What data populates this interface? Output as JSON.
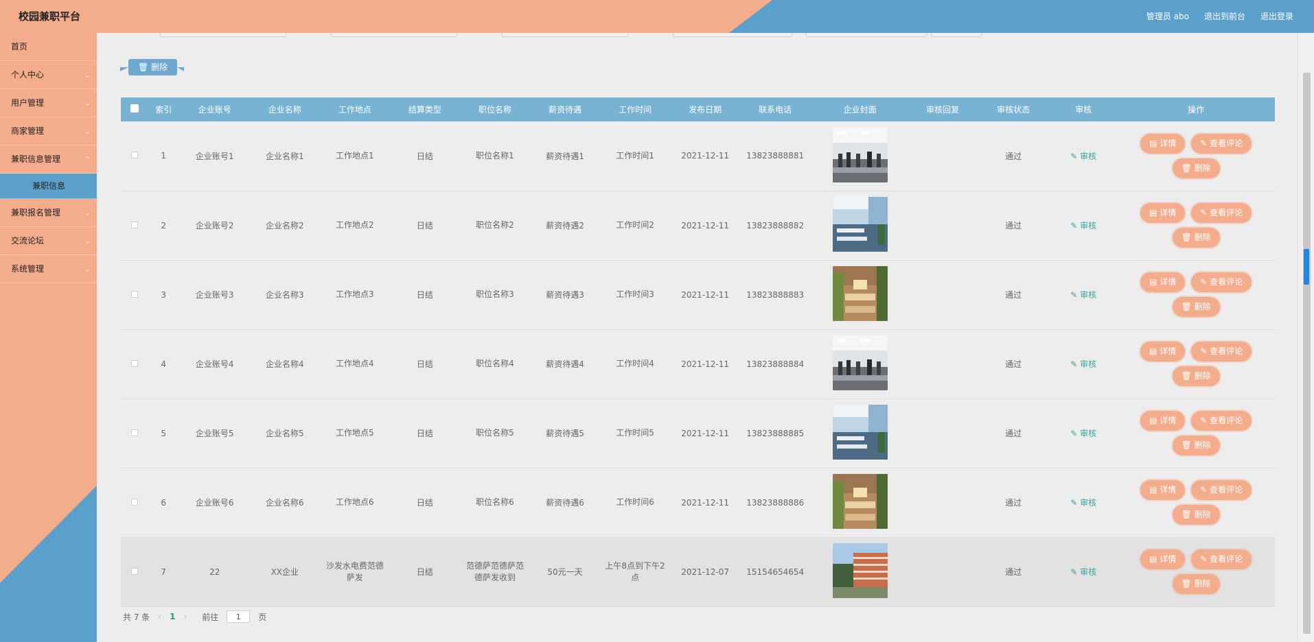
{
  "header": {
    "brand": "校园兼职平台",
    "admin": "管理员 abo",
    "to_front": "退出到前台",
    "logout": "退出登录"
  },
  "sidebar": {
    "items": [
      {
        "label": "首页"
      },
      {
        "label": "个人中心"
      },
      {
        "label": "用户管理"
      },
      {
        "label": "商家管理"
      },
      {
        "label": "兼职信息管理"
      },
      {
        "label": "兼职信息"
      },
      {
        "label": "兼职报名管理"
      },
      {
        "label": "交流论坛"
      },
      {
        "label": "系统管理"
      }
    ]
  },
  "toolbar": {
    "delete_label": "删除"
  },
  "table": {
    "headers": [
      "索引",
      "企业账号",
      "企业名称",
      "工作地点",
      "结算类型",
      "职位名称",
      "薪资待遇",
      "工作时间",
      "发布日期",
      "联系电话",
      "企业封面",
      "审核回复",
      "审核状态",
      "审核",
      "操作"
    ],
    "rows": [
      {
        "idx": "1",
        "acct": "企业账号1",
        "name": "企业名称1",
        "place": "工作地点1",
        "settle": "日结",
        "job": "职位名称1",
        "pay": "薪资待遇1",
        "time": "工作时间1",
        "date": "2021-12-11",
        "phone": "13823888881",
        "reply": "",
        "status": "通过",
        "img": "office"
      },
      {
        "idx": "2",
        "acct": "企业账号2",
        "name": "企业名称2",
        "place": "工作地点2",
        "settle": "日结",
        "job": "职位名称2",
        "pay": "薪资待遇2",
        "time": "工作时间2",
        "date": "2021-12-11",
        "phone": "13823888882",
        "reply": "",
        "status": "通过",
        "img": "glass"
      },
      {
        "idx": "3",
        "acct": "企业账号3",
        "name": "企业名称3",
        "place": "工作地点3",
        "settle": "日结",
        "job": "职位名称3",
        "pay": "薪资待遇3",
        "time": "工作时间3",
        "date": "2021-12-11",
        "phone": "13823888883",
        "reply": "",
        "status": "通过",
        "img": "wood"
      },
      {
        "idx": "4",
        "acct": "企业账号4",
        "name": "企业名称4",
        "place": "工作地点4",
        "settle": "日结",
        "job": "职位名称4",
        "pay": "薪资待遇4",
        "time": "工作时间4",
        "date": "2021-12-11",
        "phone": "13823888884",
        "reply": "",
        "status": "通过",
        "img": "office"
      },
      {
        "idx": "5",
        "acct": "企业账号5",
        "name": "企业名称5",
        "place": "工作地点5",
        "settle": "日结",
        "job": "职位名称5",
        "pay": "薪资待遇5",
        "time": "工作时间5",
        "date": "2021-12-11",
        "phone": "13823888885",
        "reply": "",
        "status": "通过",
        "img": "glass"
      },
      {
        "idx": "6",
        "acct": "企业账号6",
        "name": "企业名称6",
        "place": "工作地点6",
        "settle": "日结",
        "job": "职位名称6",
        "pay": "薪资待遇6",
        "time": "工作时间6",
        "date": "2021-12-11",
        "phone": "13823888886",
        "reply": "",
        "status": "通过",
        "img": "wood"
      },
      {
        "idx": "7",
        "acct": "22",
        "name": "XX企业",
        "place": "沙发水电费范德萨发",
        "settle": "日结",
        "job": "范德萨范德萨范德萨发收到",
        "pay": "50元一天",
        "time": "上午8点到下午2点",
        "date": "2021-12-07",
        "phone": "15154654654",
        "reply": "",
        "status": "通过",
        "img": "campus"
      }
    ],
    "audit_label": "审核",
    "detail_label": "详情",
    "comments_label": "查看评论",
    "delete_label": "删除"
  },
  "pager": {
    "total": "共 7 条",
    "page": "1",
    "goto": "前往",
    "goto_value": "1",
    "page_suffix": "页"
  },
  "colors": {
    "salmon": "#f3ac8c",
    "blue": "#5aa0cb",
    "table_header": "#78b3d4",
    "audit_link": "#3aa3a0"
  }
}
